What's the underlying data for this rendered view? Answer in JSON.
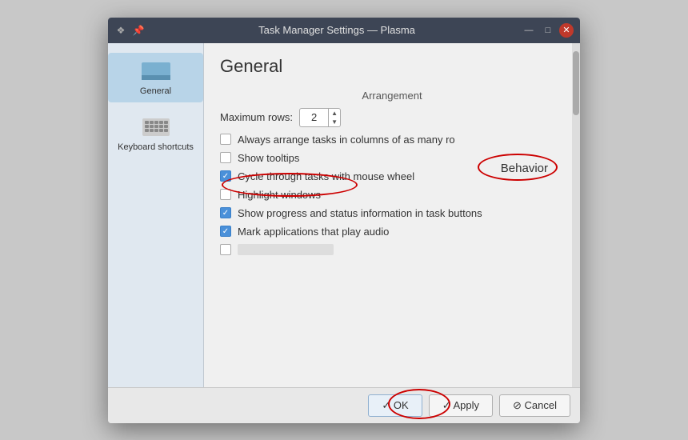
{
  "window": {
    "title": "Task Manager Settings — Plasma",
    "icon_pin": "📌",
    "icon_lock": "❖"
  },
  "titlebar": {
    "controls": {
      "minimize": "—",
      "maximize": "□",
      "close": "✕"
    }
  },
  "sidebar": {
    "items": [
      {
        "id": "general",
        "label": "General",
        "active": true
      },
      {
        "id": "keyboard-shortcuts",
        "label": "Keyboard shortcuts",
        "active": false
      }
    ]
  },
  "content": {
    "section_title": "General",
    "arrangement_label": "Arrangement",
    "max_rows_label": "Maximum rows:",
    "max_rows_value": "2",
    "checkboxes": [
      {
        "id": "always-arrange",
        "label": "Always arrange tasks in columns of as many ro",
        "checked": false
      },
      {
        "id": "show-tooltips",
        "label": "Show tooltips",
        "checked": false
      },
      {
        "id": "cycle-tasks",
        "label": "Cycle through tasks with mouse wheel",
        "checked": true
      },
      {
        "id": "highlight-windows",
        "label": "Highlight windows",
        "checked": false
      },
      {
        "id": "show-progress",
        "label": "Show progress and status information in task buttons",
        "checked": true
      },
      {
        "id": "mark-audio",
        "label": "Mark applications that play audio",
        "checked": true
      }
    ],
    "behavior_label": "Behavior"
  },
  "buttons": {
    "ok_label": "✓  OK",
    "apply_label": "✓  Apply",
    "cancel_label": "⊘  Cancel"
  },
  "annotations": {
    "tooltip_circle": true,
    "behavior_circle": true,
    "ok_circle": true
  }
}
